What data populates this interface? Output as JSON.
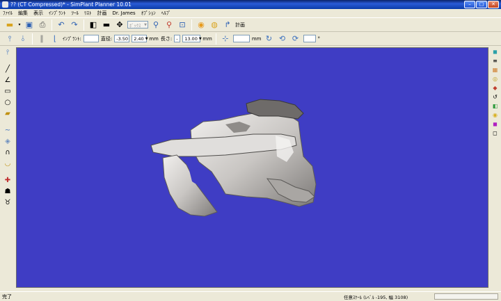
{
  "window": {
    "title": "?? (CT Compressed)* - SimPlant Planner  10.01",
    "min": "–",
    "max": "□",
    "close": "✕"
  },
  "menu": [
    "ﾌｧｲﾙ",
    "編集",
    "表示",
    "ｲﾝﾌﾟﾗﾝﾄ",
    "ﾂｰﾙ",
    "ﾘｽﾄ",
    "計画",
    "Dr. James",
    "ｵﾌﾟｼｮﾝ",
    "ﾍﾙﾌﾟ"
  ],
  "toolbar1": {
    "box_combo": "ﾎﾞｯｸｽ",
    "plan_label": "計画"
  },
  "toolbar2": {
    "implant_label": "ｲﾝﾌﾟﾗﾝﾄ:",
    "implant_value": "",
    "diameter_label": "直径:",
    "diameter_value1": "-3.50",
    "diameter_value2": "2.40",
    "unit_mm": "mm",
    "length_label": "長さ:",
    "length_value": "-",
    "length_value2": "13.00",
    "unit_mm2": "mm",
    "offset_value": "",
    "unit_mm3": "mm",
    "deg_field": "",
    "deg_unit": "°"
  },
  "status": {
    "ready": "完了",
    "scale": "任意ｽｹｰﾙ (ﾚﾍﾞﾙ -195, 幅 3108)"
  },
  "colors": {
    "viewport_bg": "#3f3dc4",
    "titlebar": "#2356d4",
    "bone": "#c9c6c3"
  }
}
